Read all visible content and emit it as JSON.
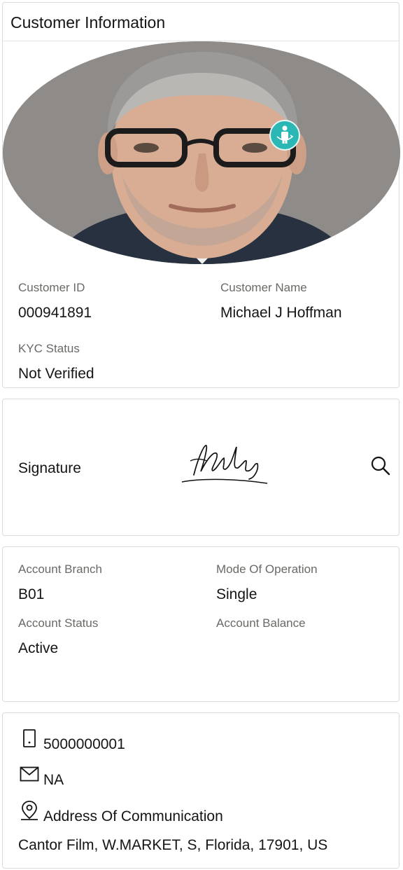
{
  "header": {
    "title": "Customer Information"
  },
  "customer": {
    "id_label": "Customer ID",
    "id_value": "000941891",
    "name_label": "Customer Name",
    "name_value": "Michael J Hoffman",
    "kyc_label": "KYC Status",
    "kyc_value": "Not Verified"
  },
  "signature": {
    "label": "Signature"
  },
  "account": {
    "branch_label": "Account Branch",
    "branch_value": "B01",
    "mode_label": "Mode Of Operation",
    "mode_value": "Single",
    "status_label": "Account Status",
    "status_value": "Active",
    "balance_label": "Account Balance",
    "balance_value": ""
  },
  "contact": {
    "phone": "5000000001",
    "email": "NA",
    "address_label": "Address Of Communication",
    "address_value": "Cantor Film, W.MARKET, S, Florida, 17901, US"
  },
  "icons": {
    "phone": "mobile-phone-icon",
    "email": "envelope-icon",
    "address": "location-pin-icon",
    "zoom": "magnifier-icon",
    "badge": "person-rotate-icon"
  },
  "colors": {
    "accent": "#2bb8b5",
    "label": "#6b6966",
    "text": "#161513",
    "border": "#dcdcdc"
  }
}
